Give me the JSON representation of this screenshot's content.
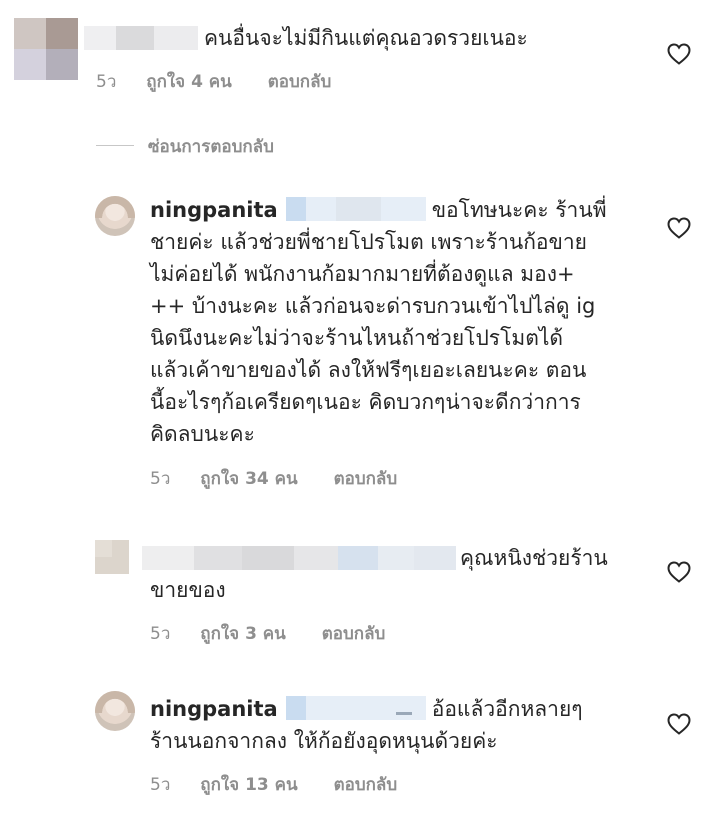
{
  "comments": [
    {
      "text": "คนอื่นจะไม่มีกินแต่คุณอวดรวยเนอะ",
      "time": "5ว",
      "likes": "ถูกใจ 4 คน",
      "reply": "ตอบกลับ"
    },
    {
      "username": "ningpanita",
      "lines": [
        "ขอโทษนะคะ ร้านพี่",
        "ชายค่ะ แล้วช่วยพี่ชายโปรโมต เพราะร้านก้อขาย",
        "ไม่ค่อยได้ พนักงานก้อมากมายที่ต้องดูแล มอง+",
        "++ บ้างนะคะ แล้วก่อนจะด่ารบกวนเข้าไปไล่ดู ig",
        "นิดนึงนะคะไม่ว่าจะร้านไหนถ้าช่วยโปรโมตได้",
        "แล้วเค้าขายของได้ ลงให้ฟรีๆเยอะเลยนะคะ ตอน",
        "นี้อะไรๆก้อเครียดๆเนอะ คิดบวกๆน่าจะดีกว่าการ",
        "คิดลบนะคะ"
      ],
      "time": "5ว",
      "likes": "ถูกใจ 34 คน",
      "reply": "ตอบกลับ"
    },
    {
      "lines": [
        "คุณหนิงช่วยร้าน",
        "ขายของ"
      ],
      "time": "5ว",
      "likes": "ถูกใจ 3 คน",
      "reply": "ตอบกลับ"
    },
    {
      "username": "ningpanita",
      "lines": [
        "อ้อแล้วอีกหลายๆ",
        "ร้านนอกจากลง ให้ก้อยังอุดหนุนด้วยค่ะ"
      ],
      "time": "5ว",
      "likes": "ถูกใจ 13 คน",
      "reply": "ตอบกลับ"
    }
  ],
  "hide_replies": "ซ่อนการตอบกลับ",
  "colors": {
    "text": "#262626",
    "secondary": "#8e8e8e",
    "divider": "#c7c7c7"
  },
  "icons": {
    "like": "heart-outline-icon"
  }
}
